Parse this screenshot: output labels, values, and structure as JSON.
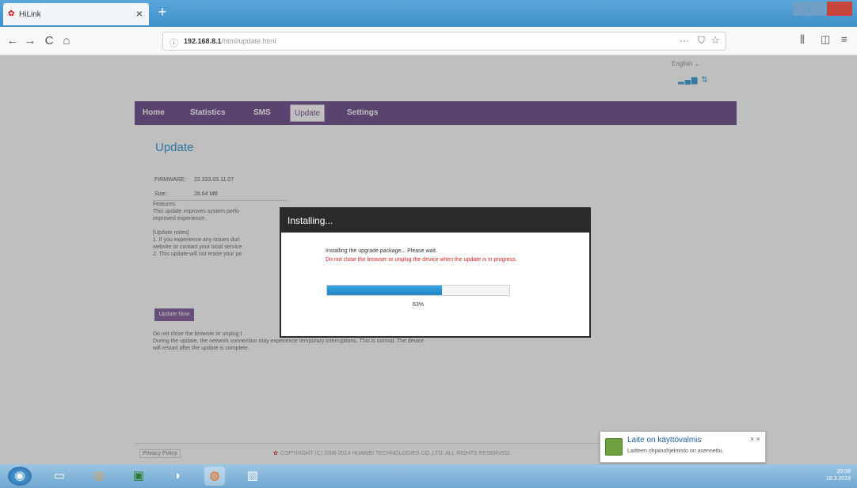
{
  "browser": {
    "tab_title": "HiLink",
    "tab_close": "×",
    "new_tab": "+",
    "nav_back": "←",
    "nav_forward": "→",
    "nav_reload": "C",
    "nav_home": "⌂",
    "url_info": "ⓘ",
    "url_host": "192.168.8.1",
    "url_path": "/html/update.html",
    "url_dots": "···",
    "pocket": "⛉",
    "star": "☆",
    "library": "⫼",
    "sidebar": "◫",
    "menu": "≡"
  },
  "page": {
    "language": "English",
    "signal": "▂▄▆ ⇅",
    "menu": [
      "Home",
      "Statistics",
      "SMS",
      "Update",
      "Settings"
    ],
    "heading": "Update",
    "firmware_label": "FIRMWARE:",
    "firmware_value": "22.333.03.11.07",
    "size_label": "Size:",
    "size_value": "28.64 MB",
    "notes": [
      "Features:",
      "This update improves system perfo",
      "improved experience.",
      "",
      "[Update notes]",
      "1. If you experience any issues duri",
      "website or contact your local service",
      "2. This update will not erase your pe"
    ],
    "update_button": "Update Now",
    "warning_lines": [
      "Do not close the browser or unplug t",
      "During the update, the network connection may experience temporary interruptions. This is normal. The device",
      "will restart after the update is complete."
    ],
    "privacy": "Privacy Policy",
    "copyright": "COPYRIGHT (C) 2006-2014 HUAWEI TECHNOLOGIES CO.,LTD. ALL RIGHTS RESERVED."
  },
  "dialog": {
    "title": "Installing...",
    "message": "Installing the upgrade package... Please wait.",
    "warning": "Do not close the browser or unplug the device when the update is in progress.",
    "progress_fraction": 0.63,
    "progress_label": "63%",
    "accent": "#1b82c4"
  },
  "taskbar": {
    "start": "◉",
    "items": [
      "▭",
      "◎",
      "▣",
      "◑",
      "◍",
      "▧"
    ],
    "clock_time": "20:08",
    "clock_date": "18.3.2019"
  },
  "notification": {
    "title": "Laite on käyttövalmis",
    "subtitle": "Laitteen ohjainohjelmisto on asennettu.",
    "close": "× ×"
  }
}
